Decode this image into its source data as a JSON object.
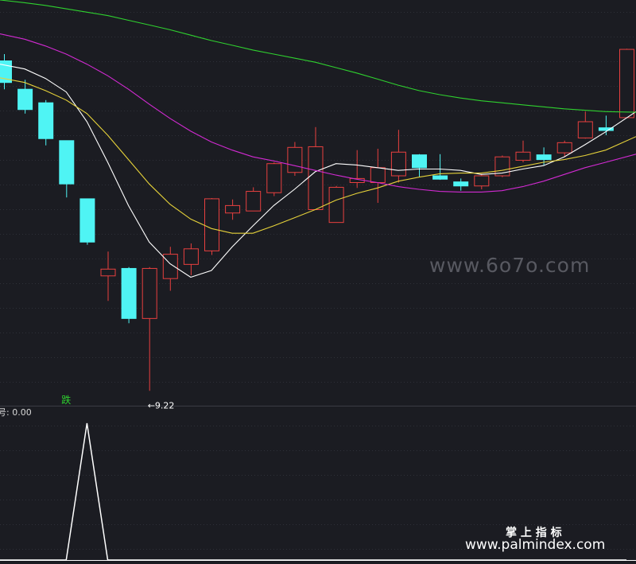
{
  "chart_data": {
    "type": "candlestick",
    "colors": {
      "background": "#1b1c22",
      "grid": "#2e3038",
      "up": "#e8403f",
      "down": "#4ff4f4",
      "ma_white": "#ffffff",
      "ma_yellow": "#e6d23a",
      "ma_magenta": "#d22ad2",
      "ma_green": "#2fd12f",
      "signal_label": "#2fd12f",
      "indicator_line": "#ffffff"
    },
    "price_range": [
      9.0,
      15.0
    ],
    "candles": [
      {
        "o": 14.1,
        "h": 14.2,
        "l": 13.68,
        "c": 13.78
      },
      {
        "o": 13.68,
        "h": 13.82,
        "l": 13.32,
        "c": 13.38
      },
      {
        "o": 13.48,
        "h": 13.52,
        "l": 12.85,
        "c": 12.95
      },
      {
        "o": 12.92,
        "h": 12.92,
        "l": 12.08,
        "c": 12.28
      },
      {
        "o": 12.06,
        "h": 12.06,
        "l": 11.38,
        "c": 11.42
      },
      {
        "o": 10.92,
        "h": 11.28,
        "l": 10.55,
        "c": 11.02
      },
      {
        "o": 11.03,
        "h": 11.05,
        "l": 10.22,
        "c": 10.29
      },
      {
        "o": 10.29,
        "h": 11.05,
        "l": 9.22,
        "c": 11.03
      },
      {
        "o": 10.88,
        "h": 11.35,
        "l": 10.7,
        "c": 11.24
      },
      {
        "o": 11.09,
        "h": 11.4,
        "l": 10.93,
        "c": 11.32
      },
      {
        "o": 11.29,
        "h": 12.07,
        "l": 11.23,
        "c": 12.06
      },
      {
        "o": 11.85,
        "h": 12.05,
        "l": 11.75,
        "c": 11.96
      },
      {
        "o": 11.88,
        "h": 12.23,
        "l": 11.88,
        "c": 12.17
      },
      {
        "o": 12.15,
        "h": 12.6,
        "l": 12.1,
        "c": 12.58
      },
      {
        "o": 12.45,
        "h": 12.9,
        "l": 12.4,
        "c": 12.82
      },
      {
        "o": 11.9,
        "h": 13.12,
        "l": 11.9,
        "c": 12.83
      },
      {
        "o": 11.71,
        "h": 12.25,
        "l": 11.71,
        "c": 12.23
      },
      {
        "o": 12.3,
        "h": 12.78,
        "l": 12.22,
        "c": 12.36
      },
      {
        "o": 12.3,
        "h": 12.8,
        "l": 12.0,
        "c": 12.52
      },
      {
        "o": 12.4,
        "h": 13.08,
        "l": 12.3,
        "c": 12.75
      },
      {
        "o": 12.71,
        "h": 12.72,
        "l": 12.38,
        "c": 12.52
      },
      {
        "o": 12.4,
        "h": 12.72,
        "l": 12.34,
        "c": 12.35
      },
      {
        "o": 12.31,
        "h": 12.36,
        "l": 12.18,
        "c": 12.25
      },
      {
        "o": 12.25,
        "h": 12.43,
        "l": 12.2,
        "c": 12.4
      },
      {
        "o": 12.4,
        "h": 12.7,
        "l": 12.38,
        "c": 12.68
      },
      {
        "o": 12.63,
        "h": 12.92,
        "l": 12.6,
        "c": 12.75
      },
      {
        "o": 12.71,
        "h": 12.82,
        "l": 12.56,
        "c": 12.64
      },
      {
        "o": 12.74,
        "h": 12.92,
        "l": 12.68,
        "c": 12.89
      },
      {
        "o": 12.96,
        "h": 13.35,
        "l": 12.95,
        "c": 13.2
      },
      {
        "o": 13.11,
        "h": 13.29,
        "l": 13.0,
        "c": 13.07
      },
      {
        "o": 13.26,
        "h": 14.28,
        "l": 13.26,
        "c": 14.27
      }
    ],
    "ma_lines": [
      {
        "color": "#ffffff",
        "values": [
          14.05,
          13.98,
          13.84,
          13.64,
          13.2,
          12.6,
          11.96,
          11.42,
          11.1,
          10.9,
          11.0,
          11.35,
          11.66,
          11.96,
          12.2,
          12.46,
          12.58,
          12.56,
          12.52,
          12.48,
          12.5,
          12.5,
          12.48,
          12.42,
          12.44,
          12.5,
          12.55,
          12.68,
          12.86,
          13.05,
          13.35
        ]
      },
      {
        "color": "#e6d23a",
        "values": [
          13.85,
          13.78,
          13.66,
          13.52,
          13.32,
          13.0,
          12.64,
          12.28,
          11.98,
          11.76,
          11.62,
          11.55,
          11.55,
          11.66,
          11.78,
          11.9,
          12.04,
          12.14,
          12.22,
          12.32,
          12.38,
          12.43,
          12.44,
          12.44,
          12.48,
          12.54,
          12.6,
          12.64,
          12.7,
          12.78,
          12.98
        ]
      },
      {
        "color": "#d22ad2",
        "values": [
          14.5,
          14.42,
          14.32,
          14.2,
          14.05,
          13.88,
          13.68,
          13.46,
          13.25,
          13.06,
          12.9,
          12.78,
          12.68,
          12.62,
          12.55,
          12.48,
          12.41,
          12.35,
          12.3,
          12.24,
          12.2,
          12.17,
          12.16,
          12.16,
          12.18,
          12.24,
          12.32,
          12.42,
          12.52,
          12.6,
          12.72
        ]
      },
      {
        "color": "#2fd12f",
        "values": [
          15.0,
          14.96,
          14.92,
          14.87,
          14.82,
          14.77,
          14.7,
          14.63,
          14.56,
          14.48,
          14.4,
          14.33,
          14.26,
          14.2,
          14.14,
          14.08,
          14.0,
          13.92,
          13.83,
          13.74,
          13.66,
          13.6,
          13.55,
          13.51,
          13.48,
          13.45,
          13.42,
          13.39,
          13.37,
          13.35,
          13.34
        ]
      }
    ],
    "low_annotation": {
      "candle_index": 7,
      "text": "9.22"
    },
    "signal_marker": {
      "candle_index": 3,
      "text": "跌"
    },
    "indicator": {
      "label_visible": "号: 0.00",
      "range": [
        0,
        1
      ],
      "values": [
        0,
        0,
        0,
        0,
        1,
        0,
        0,
        0,
        0,
        0,
        0,
        0,
        0,
        0,
        0,
        0,
        0,
        0,
        0,
        0,
        0,
        0,
        0,
        0,
        0,
        0,
        0,
        0,
        0,
        0,
        0
      ]
    },
    "grid": true
  },
  "watermarks": {
    "center": "www.6o7o.com",
    "brand": "掌 上 指 标",
    "url": "www.palmindex.com"
  }
}
